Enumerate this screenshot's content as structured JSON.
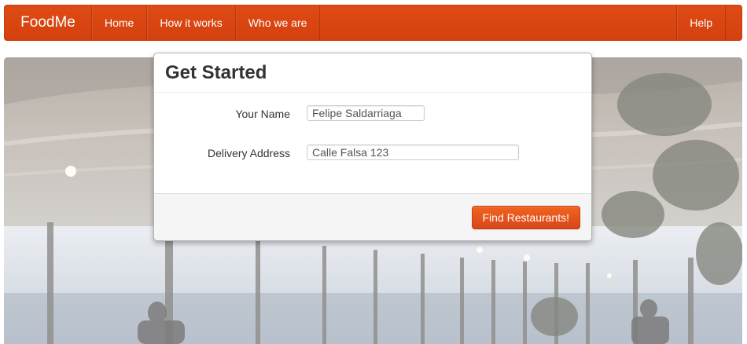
{
  "navbar": {
    "brand": "FoodMe",
    "items": [
      {
        "label": "Home"
      },
      {
        "label": "How it works"
      },
      {
        "label": "Who we are"
      }
    ],
    "help_label": "Help",
    "color": "#d94611"
  },
  "modal": {
    "title": "Get Started",
    "fields": {
      "name": {
        "label": "Your Name",
        "value": "Felipe Saldarriaga"
      },
      "address": {
        "label": "Delivery Address",
        "value": "Calle Falsa 123"
      }
    },
    "submit_label": "Find Restaurants!"
  },
  "colors": {
    "accent": "#d94611",
    "button": "#e5551c"
  }
}
